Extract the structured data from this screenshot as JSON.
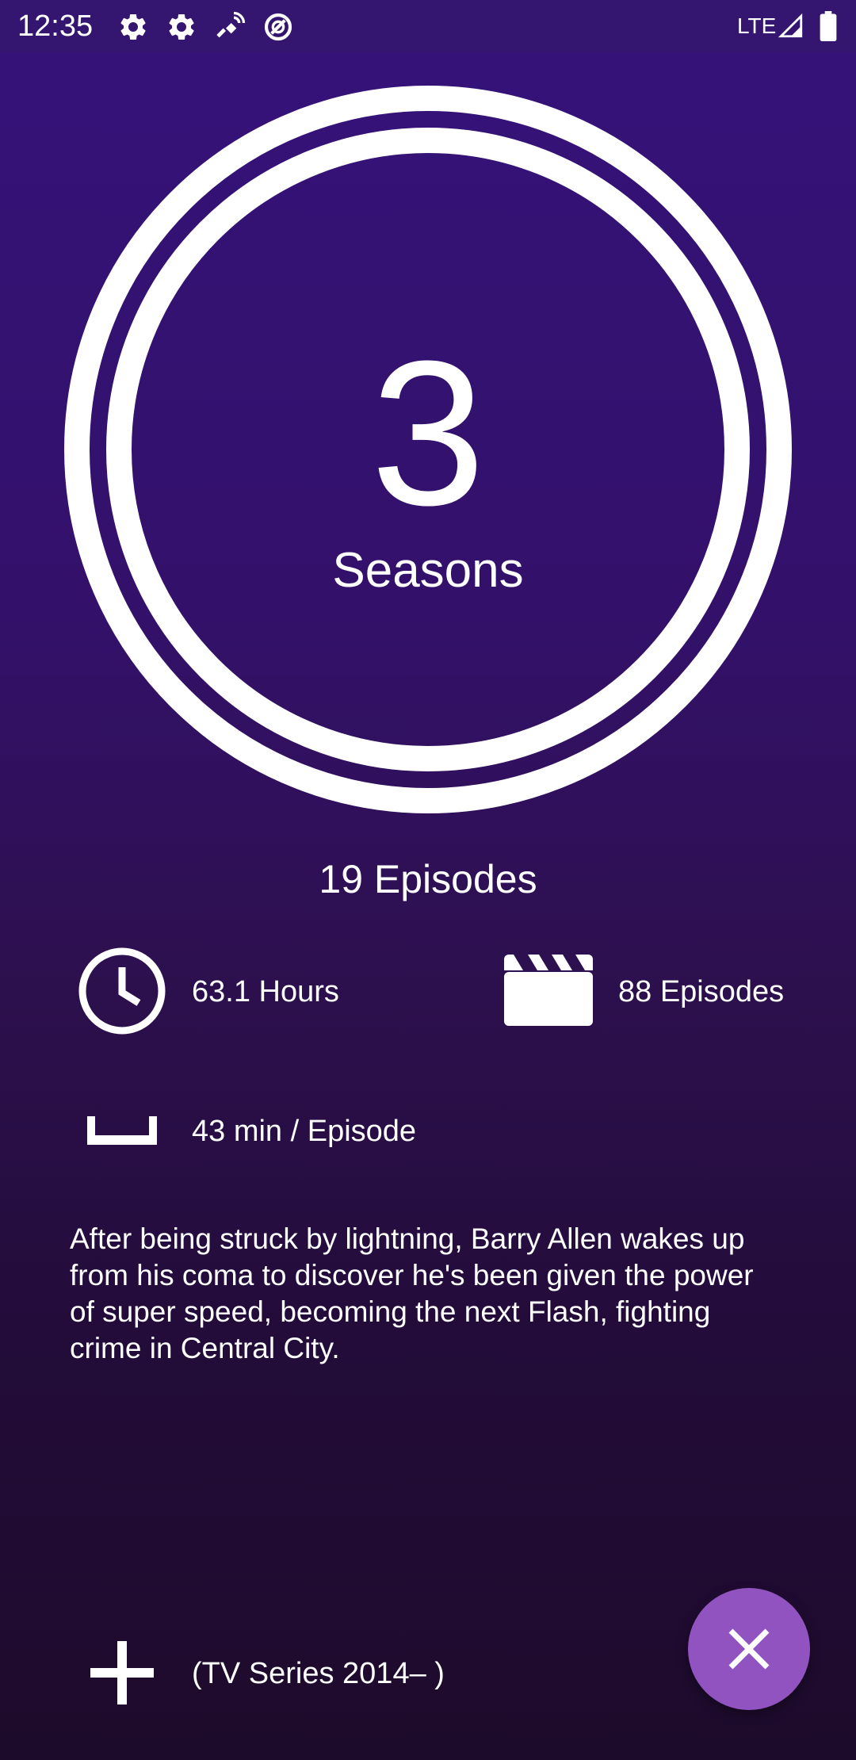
{
  "status_bar": {
    "time": "12:35",
    "network": "LTE",
    "icons": [
      "settings-icon",
      "settings-icon",
      "satellite-icon",
      "data-saver-icon",
      "signal-icon",
      "battery-icon"
    ]
  },
  "show": {
    "season_count": "3",
    "season_label": "Seasons",
    "episodes_in_view": "19 Episodes",
    "total_hours": "63.1 Hours",
    "total_episodes": "88 Episodes",
    "runtime": "43 min / Episode",
    "description": "After being struck by lightning, Barry Allen wakes up from his coma to discover he's been given the power of super speed, becoming the next Flash, fighting crime in Central City.",
    "type_label": "(TV Series 2014– )"
  },
  "colors": {
    "background_top": "#34127a",
    "background_bottom": "#1d0b2b",
    "fab": "#9153c0",
    "foreground": "#ffffff"
  }
}
